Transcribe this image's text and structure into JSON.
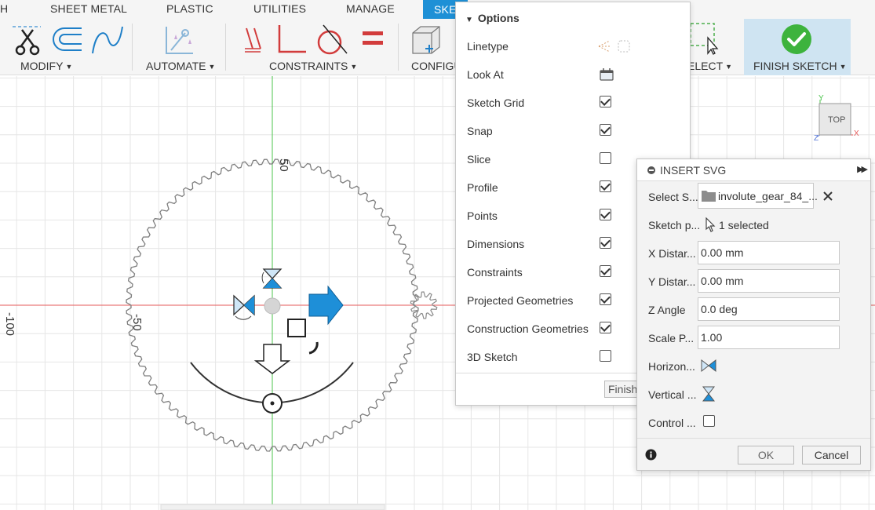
{
  "tabs": [
    {
      "label": "H"
    },
    {
      "label": "SHEET METAL"
    },
    {
      "label": "PLASTIC"
    },
    {
      "label": "UTILITIES"
    },
    {
      "label": "MANAGE"
    },
    {
      "label": "SKE"
    }
  ],
  "ribbon": {
    "modify": "MODIFY",
    "automate": "AUTOMATE",
    "constraints": "CONSTRAINTS",
    "configure": "CONFIGU",
    "select": "ELECT",
    "finish_sketch": "FINISH SKETCH"
  },
  "canvas": {
    "labels": {
      "y50": "50",
      "xneg50": "-50",
      "xneg100": "-100"
    },
    "viewcube": {
      "face": "TOP",
      "x": "X",
      "y": "Y",
      "z": "Z"
    },
    "colors": {
      "x_axis": "#e65a5a",
      "y_axis": "#4cc44c",
      "grid": "#e3e3e3",
      "gear": "#808080"
    }
  },
  "options": {
    "title": "Options",
    "rows": [
      {
        "label": "Linetype",
        "kind": "icon"
      },
      {
        "label": "Look At",
        "kind": "icon"
      },
      {
        "label": "Sketch Grid",
        "checked": true
      },
      {
        "label": "Snap",
        "checked": true
      },
      {
        "label": "Slice",
        "checked": false
      },
      {
        "label": "Profile",
        "checked": true
      },
      {
        "label": "Points",
        "checked": true
      },
      {
        "label": "Dimensions",
        "checked": true
      },
      {
        "label": "Constraints",
        "checked": true
      },
      {
        "label": "Projected Geometries",
        "checked": true
      },
      {
        "label": "Construction Geometries",
        "checked": true
      },
      {
        "label": "3D Sketch",
        "checked": false
      }
    ],
    "finish_label": "Finish"
  },
  "dialog": {
    "title": "INSERT SVG",
    "select_label": "Select S...",
    "select_value": "involute_gear_84_...",
    "plane_label": "Sketch p...",
    "plane_value": "1 selected",
    "x_label": "X Distar...",
    "x_value": "0.00 mm",
    "y_label": "Y Distar...",
    "y_value": "0.00 mm",
    "z_label": "Z Angle",
    "z_value": "0.0 deg",
    "scale_label": "Scale P...",
    "scale_value": "1.00",
    "horizontal_label": "Horizon...",
    "vertical_label": "Vertical ...",
    "control_label": "Control ...",
    "ok": "OK",
    "cancel": "Cancel"
  }
}
